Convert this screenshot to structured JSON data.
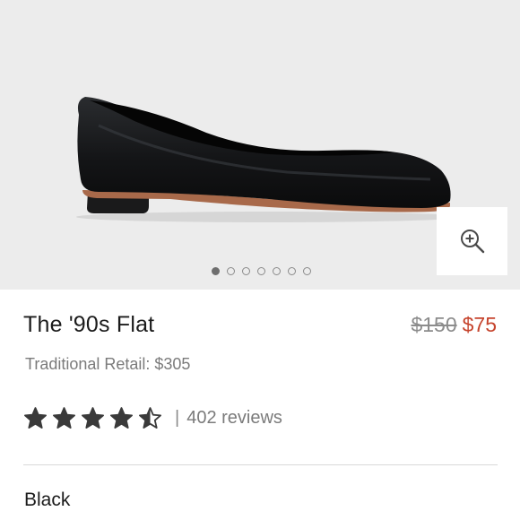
{
  "product": {
    "image_alt": "black leather ballet flat",
    "gallery": {
      "count": 7,
      "active_index": 0
    },
    "zoom_icon": "zoom-in-icon",
    "title": "The '90s Flat",
    "price_original": "$150",
    "price_sale": "$75",
    "traditional_retail": "Traditional Retail: $305",
    "rating": {
      "value": 4.5,
      "max": 5,
      "separator": "|",
      "reviews_text": "402 reviews"
    },
    "color_label": "Black"
  },
  "colors": {
    "sale_price": "#c6442d",
    "muted_text": "#7b7b7b",
    "hero_bg": "#ececec"
  }
}
